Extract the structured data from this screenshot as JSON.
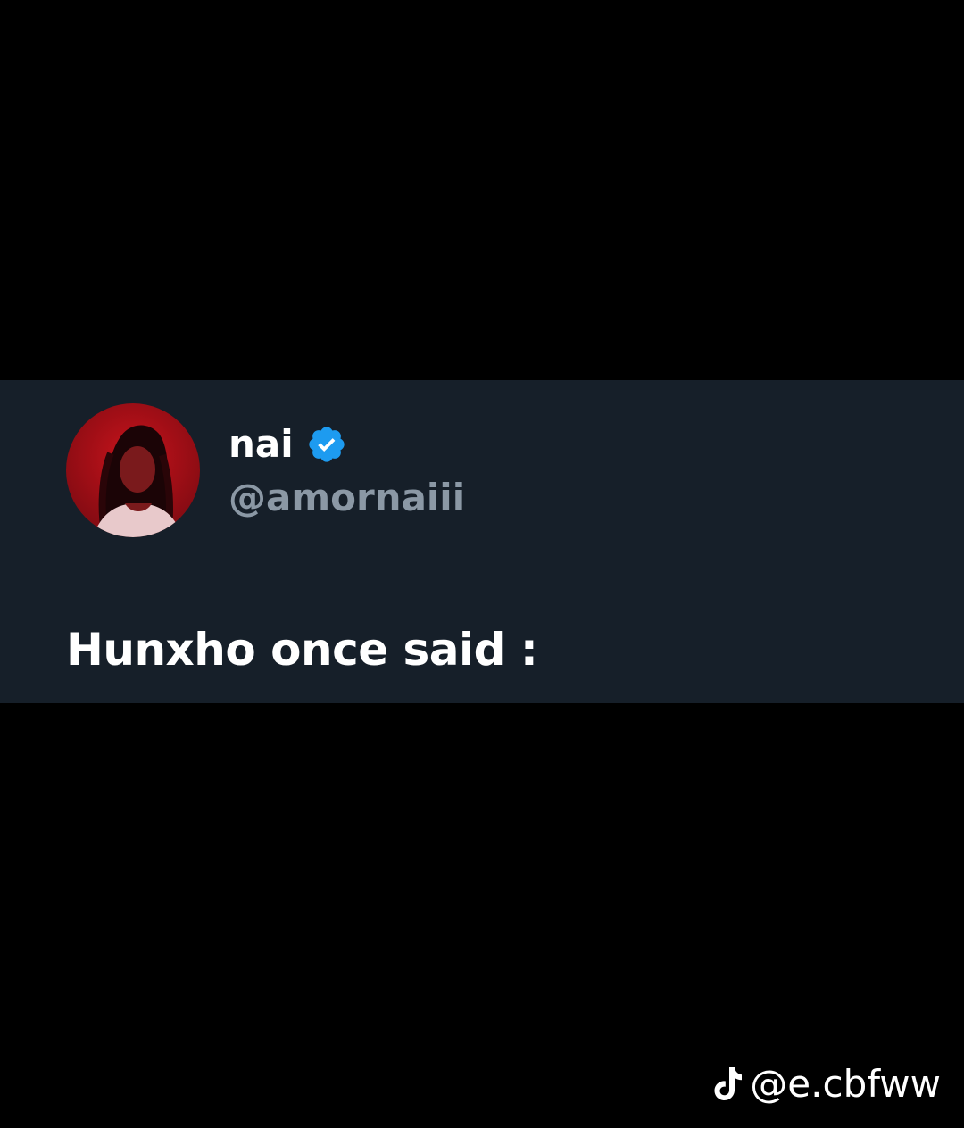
{
  "tweet": {
    "display_name": "nai",
    "verified": true,
    "handle": "@amornaiii",
    "text": "Hunxho once said :",
    "avatar_icon": "profile-photo",
    "verified_icon": "verified-badge-icon"
  },
  "watermark": {
    "icon": "tiktok-logo-icon",
    "text": "@e.cbfww"
  },
  "colors": {
    "background": "#000000",
    "card": "#161f29",
    "name": "#ffffff",
    "handle": "#8b98a5",
    "verified": "#1d9bf0",
    "avatar": "#c8141c"
  }
}
